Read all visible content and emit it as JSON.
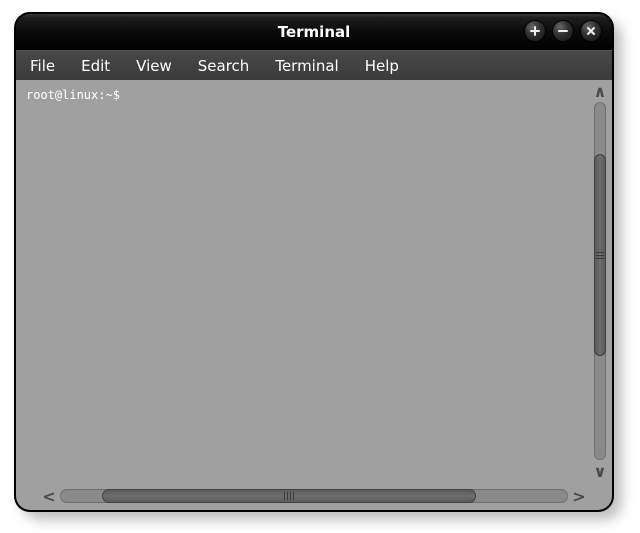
{
  "window": {
    "title": "Terminal"
  },
  "menubar": {
    "items": [
      "File",
      "Edit",
      "View",
      "Search",
      "Terminal",
      "Help"
    ]
  },
  "terminal": {
    "prompt": "root@linux:~$"
  },
  "glyphs": {
    "chev_up": "∧",
    "chev_down": "∨",
    "chev_left": "<",
    "chev_right": ">"
  }
}
